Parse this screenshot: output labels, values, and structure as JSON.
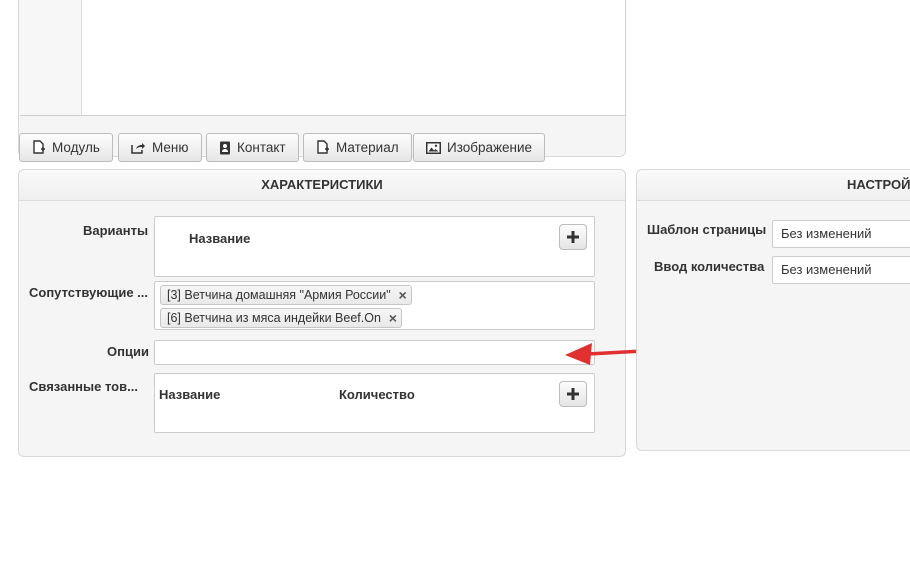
{
  "editor": {
    "buttons": [
      {
        "label": "Модуль",
        "icon": "file-plus-icon"
      },
      {
        "label": "Меню",
        "icon": "share-icon"
      },
      {
        "label": "Контакт",
        "icon": "address-book-icon"
      },
      {
        "label": "Материал",
        "icon": "file-plus-icon"
      },
      {
        "label": "Изображение",
        "icon": "picture-icon"
      }
    ]
  },
  "characteristics": {
    "title": "ХАРАКТЕРИСТИКИ",
    "variants": {
      "label": "Варианты",
      "column": "Название"
    },
    "related": {
      "label": "Сопутствующие ...",
      "tags": [
        "[3] Ветчина домашняя \"Армия России\"",
        "[6] Ветчина из мяса индейки Beef.On"
      ]
    },
    "options": {
      "label": "Опции",
      "value": ""
    },
    "linked": {
      "label": "Связанные тов...",
      "col_name": "Название",
      "col_qty": "Количество"
    }
  },
  "settings": {
    "title": "НАСТРОЙ",
    "page_template": {
      "label": "Шаблон страницы",
      "value": "Без изменений"
    },
    "qty_input": {
      "label": "Ввод количества",
      "value": "Без изменений"
    }
  },
  "colors": {
    "arrow": "#e03030"
  }
}
